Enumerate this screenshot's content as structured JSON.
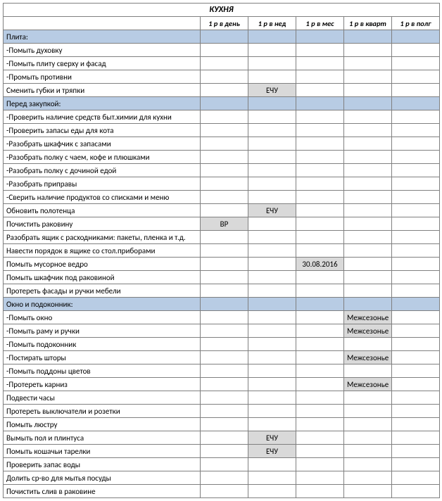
{
  "title": "КУХНЯ",
  "columns": [
    "1 р в день",
    "1 р в нед",
    "1 р в мес",
    "1 р в кварт",
    "1 р в полг"
  ],
  "rows": [
    {
      "type": "section",
      "task": "Плита:",
      "grey": []
    },
    {
      "type": "item",
      "task": "-Помыть духовку",
      "grey": [],
      "vals": [
        "",
        "",
        "",
        "",
        ""
      ]
    },
    {
      "type": "item",
      "task": "-Помыть плиту сверху и фасад",
      "grey": [],
      "vals": [
        "",
        "",
        "",
        "",
        ""
      ]
    },
    {
      "type": "item",
      "task": "-Промыть противни",
      "grey": [],
      "vals": [
        "",
        "",
        "",
        "",
        ""
      ]
    },
    {
      "type": "item",
      "task": "Сменить губки и тряпки",
      "grey": [
        1
      ],
      "vals": [
        "",
        "ЕЧУ",
        "",
        "",
        ""
      ]
    },
    {
      "type": "section",
      "task": "Перед закупкой:",
      "grey": []
    },
    {
      "type": "item",
      "task": "-Проверить наличие средств быт.химии для кухни",
      "grey": [],
      "vals": [
        "",
        "",
        "",
        "",
        ""
      ]
    },
    {
      "type": "item",
      "task": "-Проверить запасы еды для кота",
      "grey": [],
      "vals": [
        "",
        "",
        "",
        "",
        ""
      ]
    },
    {
      "type": "item",
      "task": "-Разобрать шкафчик с запасами",
      "grey": [],
      "vals": [
        "",
        "",
        "",
        "",
        ""
      ]
    },
    {
      "type": "item",
      "task": "-Разобрать полку с чаем, кофе и плюшками",
      "grey": [],
      "vals": [
        "",
        "",
        "",
        "",
        ""
      ]
    },
    {
      "type": "item",
      "task": "-Разобрать полку с дочиной едой",
      "grey": [],
      "vals": [
        "",
        "",
        "",
        "",
        ""
      ]
    },
    {
      "type": "item",
      "task": "-Разобрать приправы",
      "grey": [],
      "vals": [
        "",
        "",
        "",
        "",
        ""
      ]
    },
    {
      "type": "item",
      "task": "-Сверить наличие продуктов со списками и меню",
      "grey": [],
      "vals": [
        "",
        "",
        "",
        "",
        ""
      ]
    },
    {
      "type": "item",
      "task": "Обновить полотенца",
      "grey": [
        1
      ],
      "vals": [
        "",
        "ЕЧУ",
        "",
        "",
        ""
      ]
    },
    {
      "type": "item",
      "task": "Почистить раковину",
      "grey": [
        0
      ],
      "vals": [
        "ВР",
        "",
        "",
        "",
        ""
      ]
    },
    {
      "type": "item",
      "task": "Разобрать ящик с расходниками: пакеты, пленка и т.д.",
      "grey": [],
      "vals": [
        "",
        "",
        "",
        "",
        ""
      ]
    },
    {
      "type": "item",
      "task": "Навести порядок в ящике со стол.приборами",
      "grey": [],
      "vals": [
        "",
        "",
        "",
        "",
        ""
      ]
    },
    {
      "type": "item",
      "task": "Помыть мусорное ведро",
      "grey": [
        2
      ],
      "vals": [
        "",
        "",
        "30.08.2016",
        "",
        ""
      ]
    },
    {
      "type": "item",
      "task": "Помыть шкафчик под раковиной",
      "grey": [],
      "vals": [
        "",
        "",
        "",
        "",
        ""
      ]
    },
    {
      "type": "item",
      "task": "Протереть фасады и ручки мебели",
      "grey": [],
      "vals": [
        "",
        "",
        "",
        "",
        ""
      ]
    },
    {
      "type": "section",
      "task": "Окно и подоконник:",
      "grey": []
    },
    {
      "type": "item",
      "task": "-Помыть окно",
      "grey": [
        3
      ],
      "vals": [
        "",
        "",
        "",
        "Межсезонье",
        ""
      ]
    },
    {
      "type": "item",
      "task": "-Помыть раму и ручки",
      "grey": [
        3
      ],
      "vals": [
        "",
        "",
        "",
        "Межсезонье",
        ""
      ]
    },
    {
      "type": "item",
      "task": "-Помыть подоконник",
      "grey": [],
      "vals": [
        "",
        "",
        "",
        "",
        ""
      ]
    },
    {
      "type": "item",
      "task": "-Постирать шторы",
      "grey": [
        3
      ],
      "vals": [
        "",
        "",
        "",
        "Межсезонье",
        ""
      ]
    },
    {
      "type": "item",
      "task": "-Помыть поддоны цветов",
      "grey": [],
      "vals": [
        "",
        "",
        "",
        "",
        ""
      ]
    },
    {
      "type": "item",
      "task": "-Протереть карниз",
      "grey": [
        3
      ],
      "vals": [
        "",
        "",
        "",
        "Межсезонье",
        ""
      ]
    },
    {
      "type": "item",
      "task": "Подвести часы",
      "grey": [],
      "vals": [
        "",
        "",
        "",
        "",
        ""
      ]
    },
    {
      "type": "item",
      "task": "Протереть выключатели и розетки",
      "grey": [],
      "vals": [
        "",
        "",
        "",
        "",
        ""
      ]
    },
    {
      "type": "item",
      "task": "Помыть люстру",
      "grey": [],
      "vals": [
        "",
        "",
        "",
        "",
        ""
      ]
    },
    {
      "type": "item",
      "task": "Вымыть пол и плинтуса",
      "grey": [
        1
      ],
      "vals": [
        "",
        "ЕЧУ",
        "",
        "",
        ""
      ]
    },
    {
      "type": "item",
      "task": "Помыть кошачьи тарелки",
      "grey": [
        1
      ],
      "vals": [
        "",
        "ЕЧУ",
        "",
        "",
        ""
      ]
    },
    {
      "type": "item",
      "task": "Проверить запас воды",
      "grey": [],
      "vals": [
        "",
        "",
        "",
        "",
        ""
      ]
    },
    {
      "type": "item",
      "task": "Долить ср-во для мытья посуды",
      "grey": [],
      "vals": [
        "",
        "",
        "",
        "",
        ""
      ]
    },
    {
      "type": "item",
      "task": "Почистить слив в раковине",
      "grey": [],
      "vals": [
        "",
        "",
        "",
        "",
        ""
      ]
    }
  ]
}
